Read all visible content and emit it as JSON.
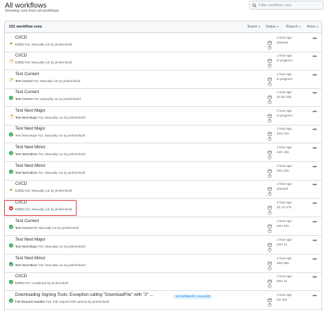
{
  "header": {
    "title": "All workflows",
    "subtitle": "Showing runs from all workflows"
  },
  "search": {
    "placeholder": "Filter workflow runs"
  },
  "list_header": {
    "count": "101 workflow runs",
    "filters": [
      "Event",
      "Status",
      "Branch",
      "Actor"
    ]
  },
  "colors": {
    "success": "#2da44e",
    "in_progress": "#bf8700",
    "failure": "#cf222e",
    "highlight": "#e0353a",
    "link": "#0969da"
  },
  "runs": [
    {
      "title": "CI/CD",
      "meta_bold": "CI/CD",
      "meta_rest": " #44: Manually run by jenlehmkuhl",
      "status": "queued",
      "time": "1 hour ago",
      "duration": "Queued",
      "status_icon": "dot-queued-icon"
    },
    {
      "title": "CI/CD",
      "meta_bold": "CI/CD",
      "meta_rest": " #43: Manually run by jenlehmkuhl",
      "status": "in_progress",
      "time": "1 hour ago",
      "duration": "In progress",
      "status_icon": "spinner-icon"
    },
    {
      "title": "Test Current",
      "meta_bold": "Test Current",
      "meta_rest": " #11: Manually run by jenlehmkuhl",
      "status": "in_progress",
      "time": "1 hour ago",
      "duration": "In progress",
      "status_icon": "spinner-icon"
    },
    {
      "title": "Test Current",
      "meta_bold": "Test Current",
      "meta_rest": " #10: Manually run by jenlehmkuhl",
      "status": "success",
      "time": "1 hour ago",
      "duration": "1h 0m 30s",
      "status_icon": "check-circle-icon"
    },
    {
      "title": "Test Next Major",
      "meta_bold": "Test Next Major",
      "meta_rest": " #12: Manually run by jenlehmkuhl",
      "status": "in_progress",
      "time": "1 hour ago",
      "duration": "In progress",
      "status_icon": "spinner-icon"
    },
    {
      "title": "Test Next Major",
      "meta_bold": "",
      "meta_rest": "Test Next Major #11: Manually run by jenlehmkuhl",
      "status": "success",
      "time": "1 hour ago",
      "duration": "44m 21s",
      "status_icon": "check-circle-icon"
    },
    {
      "title": "Test Next Minor",
      "meta_bold": "Test Next Minor",
      "meta_rest": " #12: Manually run by jenlehmkuhl",
      "status": "success",
      "time": "1 hour ago",
      "duration": "44m 18s",
      "status_icon": "check-circle-icon"
    },
    {
      "title": "Test Next Minor",
      "meta_bold": "Test Next Minor",
      "meta_rest": " #11: Manually run by jenlehmkuhl",
      "status": "success",
      "time": "1 hour ago",
      "duration": "43m 23s",
      "status_icon": "check-circle-icon"
    },
    {
      "title": "CI/CD",
      "meta_bold": "CI/CD",
      "meta_rest": " #42: Manually run by jenlehmkuhl",
      "status": "queued",
      "time": "1 hour ago",
      "duration": "Queued",
      "status_icon": "dot-queued-icon"
    },
    {
      "title": "CI/CD",
      "meta_bold": "CI/CD",
      "meta_rest": " #41: Manually run by jenlehmkuhl",
      "status": "failure",
      "time": "1 hour ago",
      "duration": "1h 1m 27s",
      "status_icon": "x-circle-icon"
    },
    {
      "title": "Test Current",
      "meta_bold": "Test Current",
      "meta_rest": " #9: Manually run by jenlehmkuhl",
      "status": "success",
      "time": "1 hour ago",
      "duration": "22m 15s",
      "status_icon": "check-circle-icon"
    },
    {
      "title": "Test Next Major",
      "meta_bold": "Test Next Major",
      "meta_rest": " #10: Manually run by jenlehmkuhl",
      "status": "success",
      "time": "1 hour ago",
      "duration": "24m 1s",
      "status_icon": "check-circle-icon"
    },
    {
      "title": "Test Next Minor",
      "meta_bold": "Test Next Minor",
      "meta_rest": " #10: Manually run by jenlehmkuhl",
      "status": "success",
      "time": "1 hour ago",
      "duration": "20m 58s",
      "status_icon": "check-circle-icon"
    },
    {
      "title": "CI/CD",
      "meta_bold": "CI/CD",
      "meta_rest": " #37: completed by jenlehmkuhl",
      "status": "success",
      "time": "1 hour ago",
      "duration": "40m 1s",
      "status_icon": "check-circle-icon"
    },
    {
      "title": "Downloading Signing Tools: Exception calling \"DownloadFile\" with \"2\" ...",
      "meta_bold": "Full Request Handler",
      "meta_rest": " #16: Pull request #35 opened by jenlehmkuhl",
      "status": "success",
      "time": "1 hour ago",
      "duration": "1m 18s",
      "status_icon": "check-circle-icon",
      "branch": "jenlehmkuhl/issue34"
    }
  ]
}
